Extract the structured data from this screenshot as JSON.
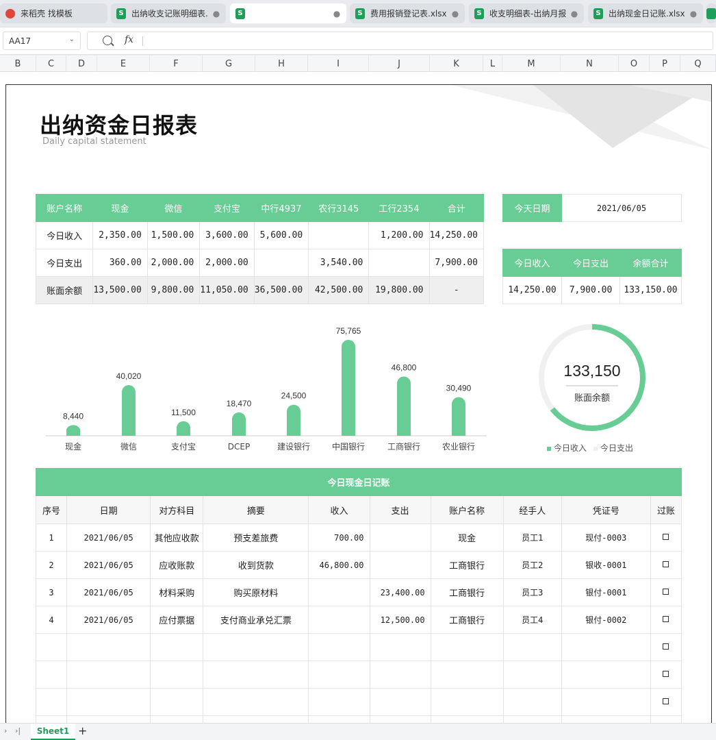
{
  "tabs": [
    {
      "label": "来稻壳 找模板",
      "icon": "docer-icon"
    },
    {
      "label": "出纳收支记账明细表...",
      "icon": "sheet-icon"
    },
    {
      "label": "",
      "icon": "sheet-icon"
    },
    {
      "label": "费用报销登记表.xlsx",
      "icon": "sheet-icon"
    },
    {
      "label": "收支明细表-出纳月报...",
      "icon": "sheet-icon"
    },
    {
      "label": "出纳现金日记账.xlsx",
      "icon": "sheet-icon"
    }
  ],
  "formula_bar": {
    "name_box": "AA17",
    "fx": "fx",
    "formula": ""
  },
  "columns": [
    "B",
    "C",
    "D",
    "E",
    "F",
    "G",
    "H",
    "I",
    "J",
    "K",
    "L",
    "M",
    "N",
    "O",
    "P",
    "Q"
  ],
  "report": {
    "title": "出纳资金日报表",
    "subtitle": "Daily capital statement"
  },
  "summary": {
    "headers": [
      "账户名称",
      "现金",
      "微信",
      "支付宝",
      "中行4937",
      "农行3145",
      "工行2354",
      "合计"
    ],
    "rows": [
      {
        "label": "今日收入",
        "values": [
          "2,350.00",
          "1,500.00",
          "3,600.00",
          "5,600.00",
          "",
          "1,200.00",
          "14,250.00"
        ]
      },
      {
        "label": "今日支出",
        "values": [
          "360.00",
          "2,000.00",
          "2,000.00",
          "",
          "3,540.00",
          "",
          "7,900.00"
        ]
      },
      {
        "label": "账面余额",
        "values": [
          "13,500.00",
          "9,800.00",
          "11,050.00",
          "36,500.00",
          "42,500.00",
          "19,800.00",
          "-"
        ]
      }
    ]
  },
  "today": {
    "label": "今天日期",
    "value": "2021/06/05"
  },
  "totals": {
    "headers": [
      "今日收入",
      "今日支出",
      "余额合计"
    ],
    "values": [
      "14,250.00",
      "7,900.00",
      "133,150.00"
    ]
  },
  "chart_data": [
    {
      "type": "bar",
      "categories": [
        "现金",
        "微信",
        "支付宝",
        "DCEP",
        "建设银行",
        "中国银行",
        "工商银行",
        "农业银行"
      ],
      "values": [
        8440,
        40020,
        11500,
        18470,
        24500,
        75765,
        46800,
        30490
      ],
      "labels": [
        "8,440",
        "40,020",
        "11,500",
        "18,470",
        "24,500",
        "75,765",
        "46,800",
        "30,490"
      ],
      "color": "#68cc95"
    },
    {
      "type": "pie",
      "center_value": "133,150",
      "center_label": "账面余额",
      "series": [
        {
          "name": "今日收入",
          "value": 14250,
          "color": "#68cc95"
        },
        {
          "name": "今日支出",
          "value": 7900,
          "color": "#f0f0f0"
        }
      ]
    }
  ],
  "ledger": {
    "title": "今日现金日记账",
    "headers": [
      "序号",
      "日期",
      "对方科目",
      "摘要",
      "收入",
      "支出",
      "账户名称",
      "经手人",
      "凭证号",
      "过账"
    ],
    "rows": [
      [
        "1",
        "2021/06/05",
        "其他应收款",
        "预支差旅费",
        "700.00",
        "",
        "现金",
        "员工1",
        "现付-0003"
      ],
      [
        "2",
        "2021/06/05",
        "应收账款",
        "收到货款",
        "46,800.00",
        "",
        "工商银行",
        "员工2",
        "银收-0001"
      ],
      [
        "3",
        "2021/06/05",
        "材料采购",
        "购买原材料",
        "",
        "23,400.00",
        "工商银行",
        "员工3",
        "银付-0001"
      ],
      [
        "4",
        "2021/06/05",
        "应付票据",
        "支付商业承兑汇票",
        "",
        "12,500.00",
        "工商银行",
        "员工4",
        "银付-0002"
      ],
      [
        "",
        "",
        "",
        "",
        "",
        "",
        "",
        "",
        ""
      ],
      [
        "",
        "",
        "",
        "",
        "",
        "",
        "",
        "",
        ""
      ],
      [
        "",
        "",
        "",
        "",
        "",
        "",
        "",
        "",
        ""
      ],
      [
        "",
        "",
        "",
        "",
        "",
        "",
        "",
        "",
        ""
      ]
    ]
  },
  "sheet_tab": "Sheet1",
  "add_sheet": "+"
}
